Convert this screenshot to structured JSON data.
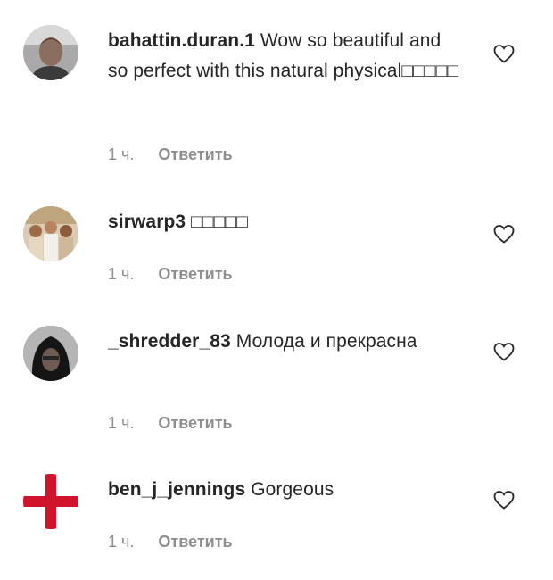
{
  "comments": [
    {
      "username": "bahattin.duran.1",
      "text": "Wow so beautiful and so perfect with this natural physical□□□□□",
      "time": "1 ч.",
      "reply_label": "Ответить",
      "avatar_icon": "avatar-photo-man"
    },
    {
      "username": "sirwarp3",
      "text": "□□□□□",
      "time": "1 ч.",
      "reply_label": "Ответить",
      "avatar_icon": "avatar-photo-group"
    },
    {
      "username": "_shredder_83",
      "text": "Молода и прекрасна",
      "time": "1 ч.",
      "reply_label": "Ответить",
      "avatar_icon": "avatar-photo-hooded"
    },
    {
      "username": "ben_j_jennings",
      "text": "Gorgeous",
      "time": "1 ч.",
      "reply_label": "Ответить",
      "avatar_icon": "avatar-england-flag"
    }
  ],
  "colors": {
    "text": "#262626",
    "meta": "#8e8e8e",
    "flag_red": "#cf142b"
  }
}
